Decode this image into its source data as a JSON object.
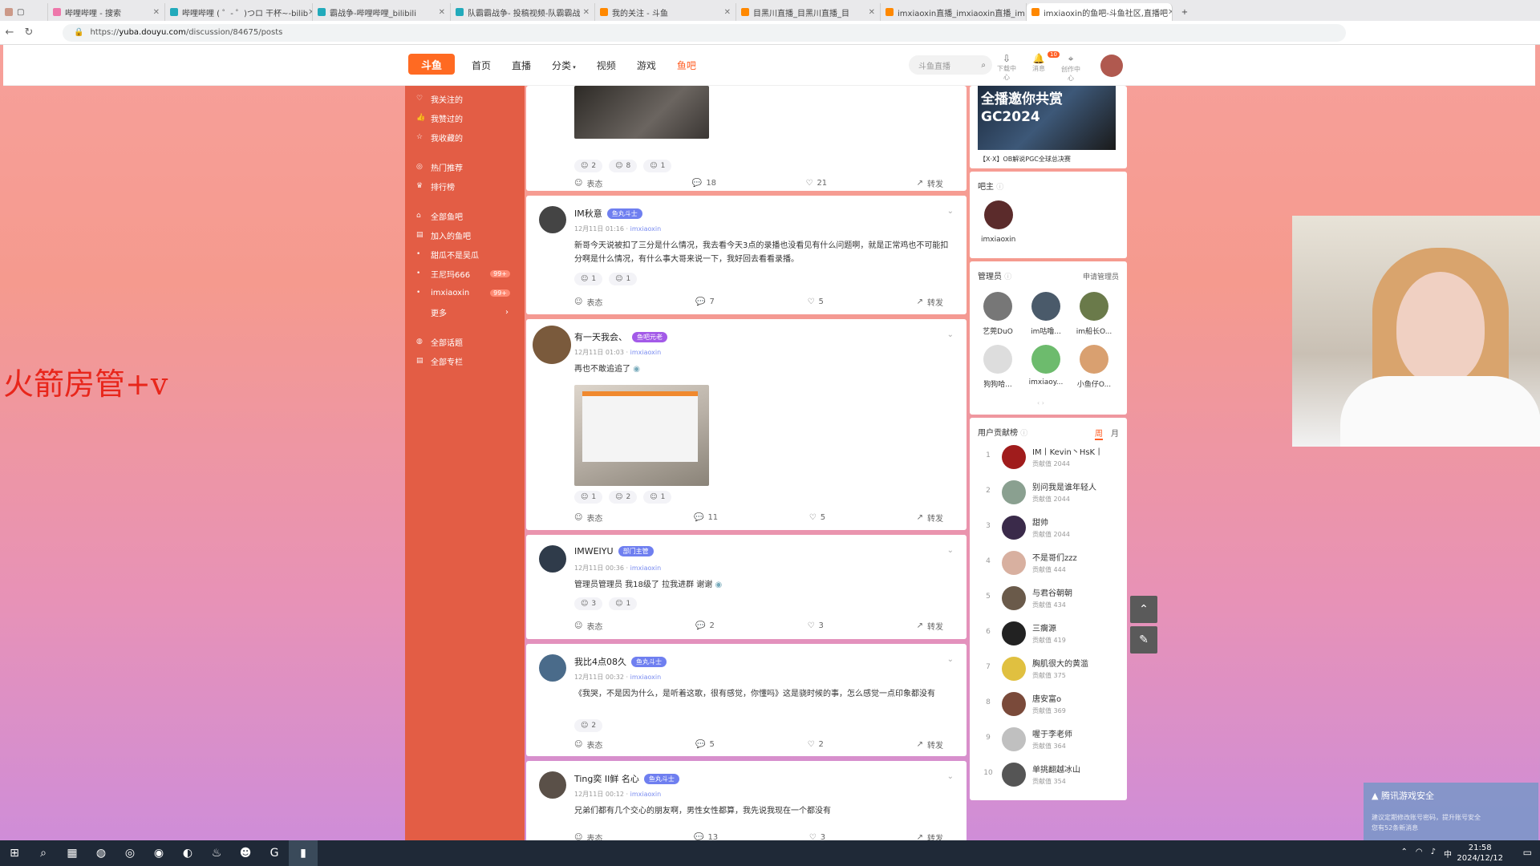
{
  "browser": {
    "tabs": [
      {
        "title": "哔哩哔哩 - 搜索"
      },
      {
        "title": "哔哩哔哩 ( ゜- ゜)つロ 干杯~-bilib"
      },
      {
        "title": "霸战争-哔哩哔哩_bilibili"
      },
      {
        "title": "队霸霸战争- 投稿视频-队霸霸战"
      },
      {
        "title": "我的关注 - 斗鱼"
      },
      {
        "title": "目黑川直播_目黑川直播_目"
      },
      {
        "title": "imxiaoxin直播_imxiaoxin直播_im"
      },
      {
        "title": "imxiaoxin的鱼吧-斗鱼社区,直播吧"
      }
    ],
    "url_prefix": "https://",
    "url_host": "yuba.douyu.com",
    "url_path": "/discussion/84675/posts"
  },
  "header": {
    "logo": "斗鱼",
    "nav": [
      "首页",
      "直播",
      "分类",
      "视频",
      "游戏",
      "鱼吧"
    ],
    "search_placeholder": "斗鱼直播",
    "tools": [
      "下载中心",
      "消息",
      "创作中心"
    ],
    "msg_badge": "10"
  },
  "overlay_text": "火箭房管+v",
  "sidebar": {
    "items": [
      {
        "label": "我关注的",
        "icon": "heart-icon"
      },
      {
        "label": "我赞过的",
        "icon": "thumb-icon"
      },
      {
        "label": "我收藏的",
        "icon": "star-icon"
      },
      {
        "label": "热门推荐",
        "icon": "fire-icon"
      },
      {
        "label": "排行榜",
        "icon": "trophy-icon"
      },
      {
        "label": "全部鱼吧",
        "icon": "home-icon"
      },
      {
        "label": "加入的鱼吧",
        "icon": "doc-icon"
      },
      {
        "label": "甜瓜不是吴瓜",
        "icon": "dot-icon"
      },
      {
        "label": "王尼玛666",
        "icon": "dot-icon",
        "count": "99+"
      },
      {
        "label": "imxiaoxin",
        "icon": "dot-icon",
        "count": "99+"
      },
      {
        "label": "更多",
        "icon": ""
      },
      {
        "label": "全部话题",
        "icon": "hash-icon"
      },
      {
        "label": "全部专栏",
        "icon": "doc-icon"
      }
    ]
  },
  "posts": [
    {
      "name": "",
      "tag": "",
      "meta": "",
      "text": "",
      "reacts": [
        "2",
        "8",
        "1"
      ],
      "actions": [
        "表态",
        "18",
        "21",
        "转发"
      ]
    },
    {
      "name": "IM秋意",
      "tag": "鱼丸斗士",
      "date": "12月11日 01:16",
      "sep": " · ",
      "bar": "imxiaoxin",
      "text": "新哥今天说被扣了三分是什么情况，我去看今天3点的录播也没看见有什么问题啊，就是正常鸡也不可能扣分啊是什么情况，有什么事大哥来说一下，我好回去看看录播。",
      "reacts": [
        "1",
        "1"
      ],
      "actions": [
        "表态",
        "7",
        "5",
        "转发"
      ]
    },
    {
      "name": "有一天我会、",
      "tag": "鱼吧元老",
      "date": "12月11日 01:03",
      "sep": " · ",
      "bar": "imxiaoxin",
      "text": "再也不敢追追了",
      "reacts": [
        "1",
        "2",
        "1"
      ],
      "actions": [
        "表态",
        "11",
        "5",
        "转发"
      ]
    },
    {
      "name": "IMWEIYU",
      "tag": "部门主管",
      "date": "12月11日 00:36",
      "sep": " · ",
      "bar": "imxiaoxin",
      "text": "管理员管理员 我18级了 拉我进群 谢谢",
      "reacts": [
        "3",
        "1"
      ],
      "actions": [
        "表态",
        "2",
        "3",
        "转发"
      ]
    },
    {
      "name": "我比4点08久",
      "tag": "鱼丸斗士",
      "date": "12月11日 00:32",
      "sep": " · ",
      "bar": "imxiaoxin",
      "text": "《我哭，不是因为什么，是听着这歌，很有感觉，你懂吗》这是骁时候的事，怎么感觉一点印象都没有",
      "reacts": [
        "2"
      ],
      "actions": [
        "表态",
        "5",
        "2",
        "转发"
      ]
    },
    {
      "name": "Ting奕 II鲜 名心",
      "tag": "鱼丸斗士",
      "date": "12月11日 00:12",
      "sep": " · ",
      "bar": "imxiaoxin",
      "text": "兄弟们都有几个交心的朋友啊，男性女性都算，我先说我现在一个都没有",
      "reacts": [],
      "actions": [
        "表态",
        "13",
        "3",
        "转发"
      ]
    }
  ],
  "right": {
    "banner_caption": "【X·X】OB解说PGC全球总决赛",
    "banner_text": "全播邀你共赏 GC2024",
    "owner_title": "吧主",
    "owner_name": "imxiaoxin",
    "admin_title": "管理员",
    "admin_link": "申请管理员",
    "admins": [
      "艺莞DuO",
      "im咕噜...",
      "im船长O...",
      "狗狗哈...",
      "imxiaoy...",
      "小鱼仔O..."
    ],
    "rank_title": "用户贡献榜",
    "periods": [
      "周",
      "月"
    ],
    "rank_label": "贡献值",
    "ranking": [
      {
        "rank": "1",
        "name": "IM丨Kevin丶HsK丨",
        "value": "2044"
      },
      {
        "rank": "2",
        "name": "别问我是谁年轻人",
        "value": "2044"
      },
      {
        "rank": "3",
        "name": "甜帅",
        "value": "2044"
      },
      {
        "rank": "4",
        "name": "不是哥们zzz",
        "value": "444"
      },
      {
        "rank": "5",
        "name": "与君谷朝朝",
        "value": "434"
      },
      {
        "rank": "6",
        "name": "三瘸源",
        "value": "419"
      },
      {
        "rank": "7",
        "name": "胸肌很大的黄滥",
        "value": "375"
      },
      {
        "rank": "8",
        "name": "唐安富o",
        "value": "369"
      },
      {
        "rank": "9",
        "name": "喔于李老师",
        "value": "364"
      },
      {
        "rank": "10",
        "name": "单挑翻越冰山",
        "value": "354"
      }
    ]
  },
  "toast": {
    "title": "腾讯游戏安全",
    "line1": "建议定期修改账号密码，提升账号安全",
    "line2": "您有52条新消息"
  },
  "taskbar": {
    "time": "21:58",
    "date": "2024/12/12",
    "ime": "中"
  }
}
